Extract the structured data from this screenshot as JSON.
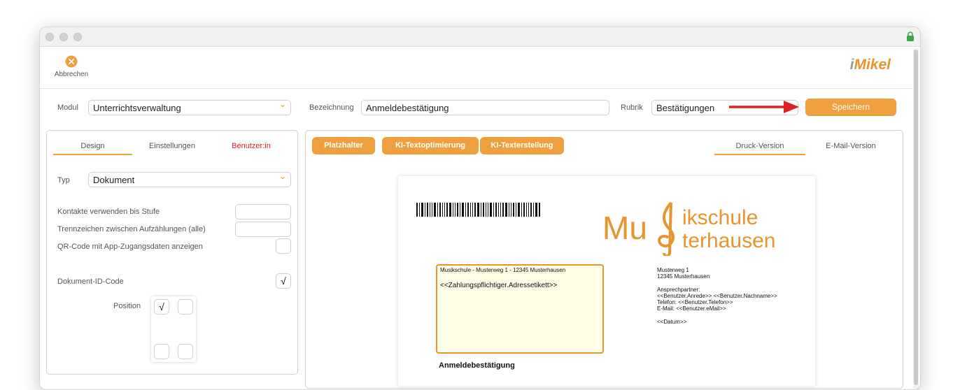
{
  "toolbar": {
    "cancel_label": "Abbrechen",
    "logo_prefix": "i",
    "logo_text": "Mikel"
  },
  "form": {
    "modul_label": "Modul",
    "modul_value": "Unterrichtsverwaltung",
    "bezeichnung_label": "Bezeichnung",
    "bezeichnung_value": "Anmeldebestätigung",
    "rubrik_label": "Rubrik",
    "rubrik_value": "Bestätigungen",
    "save_label": "Speichern"
  },
  "left_panel": {
    "tabs": [
      {
        "label": "Design"
      },
      {
        "label": "Einstellungen"
      },
      {
        "label": "Benutzer:in"
      }
    ],
    "typ_label": "Typ",
    "typ_value": "Dokument",
    "kontakte_label": "Kontakte verwenden bis Stufe",
    "trennzeichen_label": "Trennzeichen zwischen Aufzählungen (alle)",
    "qr_label": "QR-Code mit App-Zugangsdaten anzeigen",
    "docid_label": "Dokument-ID-Code",
    "position_label": "Position",
    "check_mark": "√"
  },
  "right_panel": {
    "buttons": [
      {
        "label": "Platzhalter"
      },
      {
        "label": "KI-Textoptimierung"
      },
      {
        "label": "KI-Texterstellung"
      }
    ],
    "tabs": [
      {
        "label": "Druck-Version"
      },
      {
        "label": "E-Mail-Version"
      }
    ]
  },
  "document": {
    "logo_line1": "Musikschule",
    "logo_line2": "Musterhausen",
    "sender_line": "Musikschule - Musterweg 1 - 12345 Musterhausen",
    "address_placeholder": "<<Zahlungspflichtiger.Adressetikett>>",
    "info": [
      "Musterweg 1",
      "12345 Musterhausen",
      "",
      "Ansprechpartner:",
      "<<Benutzer.Anrede>> <<Benutzer.Nachname>>",
      "Telefon: <<Benutzer.Telefon>>",
      "E-Mail: <<Benutzer.eMail>>",
      "",
      "<<Datum>>"
    ],
    "heading": "Anmeldebestätigung"
  },
  "colors": {
    "accent": "#eea03e",
    "arrow": "#e02020",
    "tab_red": "#e02020"
  }
}
